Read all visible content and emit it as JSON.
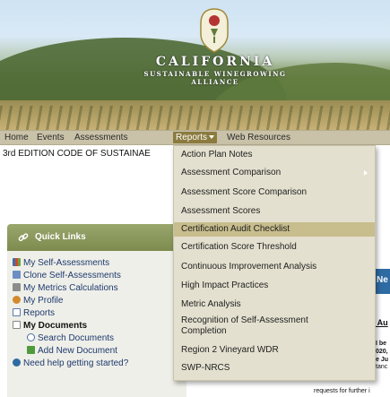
{
  "brand": {
    "name": "CALIFORNIA",
    "line1": "SUSTAINABLE WINEGROWING",
    "line2": "ALLIANCE"
  },
  "nav": {
    "items": [
      "Home",
      "Events",
      "Assessments",
      "Reports",
      "Web Resources"
    ]
  },
  "edition_text": "3rd EDITION CODE OF SUSTAINAE",
  "reports_menu": {
    "items": [
      "Action Plan Notes",
      "Assessment Comparison",
      "Assessment Score Comparison",
      "Assessment Scores",
      "Certification Audit Checklist",
      "Certification Score Threshold",
      "Continuous Improvement Analysis",
      "High Impact Practices",
      "Metric Analysis",
      "Recognition of Self-Assessment",
      "Completion",
      "Region 2 Vineyard WDR",
      "SWP-NRCS"
    ],
    "highlighted": "Certification Audit Checklist"
  },
  "quick_links": {
    "title": "Quick Links",
    "items": [
      "My Self-Assessments",
      "Clone Self-Assessments",
      "My Metrics Calculations",
      "My Profile",
      "Reports",
      "My Documents",
      "Search Documents",
      "Add New Document",
      "Need help getting started?"
    ]
  },
  "right_panel": {
    "tab_label": "Ne",
    "link_text": "r Au",
    "line1": "I be",
    "line2": "020,",
    "line3": "e Ju",
    "line4": "tanc",
    "bottom_text": "requests for further i"
  },
  "colors": {
    "nav_bg": "#c9c2a8",
    "reports_active": "#8b7b3f",
    "menu_bg": "#e3e0cf",
    "menu_highlight": "#c8bd8d",
    "quick_links_header": "#8a9760",
    "link": "#1d3a6e"
  }
}
